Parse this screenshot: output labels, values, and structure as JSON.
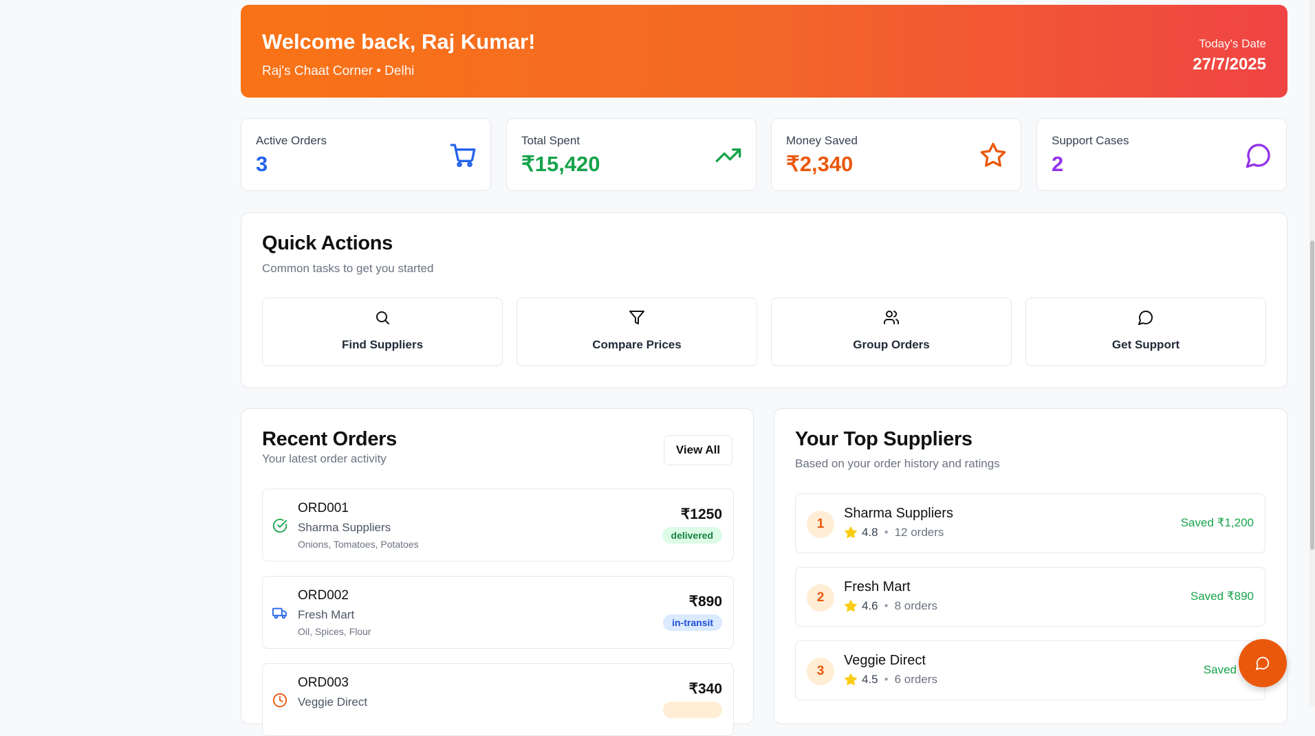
{
  "banner": {
    "welcome": "Welcome back, Raj Kumar!",
    "business": "Raj's Chaat Corner • Delhi",
    "date_label": "Today's Date",
    "date": "27/7/2025"
  },
  "stats": [
    {
      "label": "Active Orders",
      "value": "3",
      "icon": "cart-icon",
      "color": "#2563eb"
    },
    {
      "label": "Total Spent",
      "value": "₹15,420",
      "icon": "trending-up-icon",
      "color": "#16a34a"
    },
    {
      "label": "Money Saved",
      "value": "₹2,340",
      "icon": "star-icon",
      "color": "#ea580c"
    },
    {
      "label": "Support Cases",
      "value": "2",
      "icon": "message-circle-icon",
      "color": "#9333ea"
    }
  ],
  "quick_actions": {
    "title": "Quick Actions",
    "subtitle": "Common tasks to get you started",
    "items": [
      {
        "label": "Find Suppliers",
        "icon": "search-icon"
      },
      {
        "label": "Compare Prices",
        "icon": "filter-icon"
      },
      {
        "label": "Group Orders",
        "icon": "users-icon"
      },
      {
        "label": "Get Support",
        "icon": "message-circle-icon"
      }
    ]
  },
  "recent_orders": {
    "title": "Recent Orders",
    "subtitle": "Your latest order activity",
    "view_all": "View All",
    "orders": [
      {
        "id": "ORD001",
        "supplier": "Sharma Suppliers",
        "items": "Onions, Tomatoes, Potatoes",
        "amount": "₹1250",
        "status": "delivered",
        "icon": "check-circle-icon"
      },
      {
        "id": "ORD002",
        "supplier": "Fresh Mart",
        "items": "Oil, Spices, Flour",
        "amount": "₹890",
        "status": "in-transit",
        "icon": "truck-icon"
      },
      {
        "id": "ORD003",
        "supplier": "Veggie Direct",
        "items": "",
        "amount": "₹340",
        "status": "",
        "icon": "clock-icon"
      }
    ]
  },
  "top_suppliers": {
    "title": "Your Top Suppliers",
    "subtitle": "Based on your order history and ratings",
    "suppliers": [
      {
        "rank": "1",
        "name": "Sharma Suppliers",
        "rating": "4.8",
        "orders": "12 orders",
        "saved": "Saved ₹1,200"
      },
      {
        "rank": "2",
        "name": "Fresh Mart",
        "rating": "4.6",
        "orders": "8 orders",
        "saved": "Saved ₹890"
      },
      {
        "rank": "3",
        "name": "Veggie Direct",
        "rating": "4.5",
        "orders": "6 orders",
        "saved": "Saved ₹4"
      }
    ]
  },
  "colors": {
    "brand_orange": "#f97316",
    "brand_red": "#ef4444",
    "success": "#16a34a",
    "info": "#2563eb"
  },
  "chat_button_icon": "message-circle-icon"
}
